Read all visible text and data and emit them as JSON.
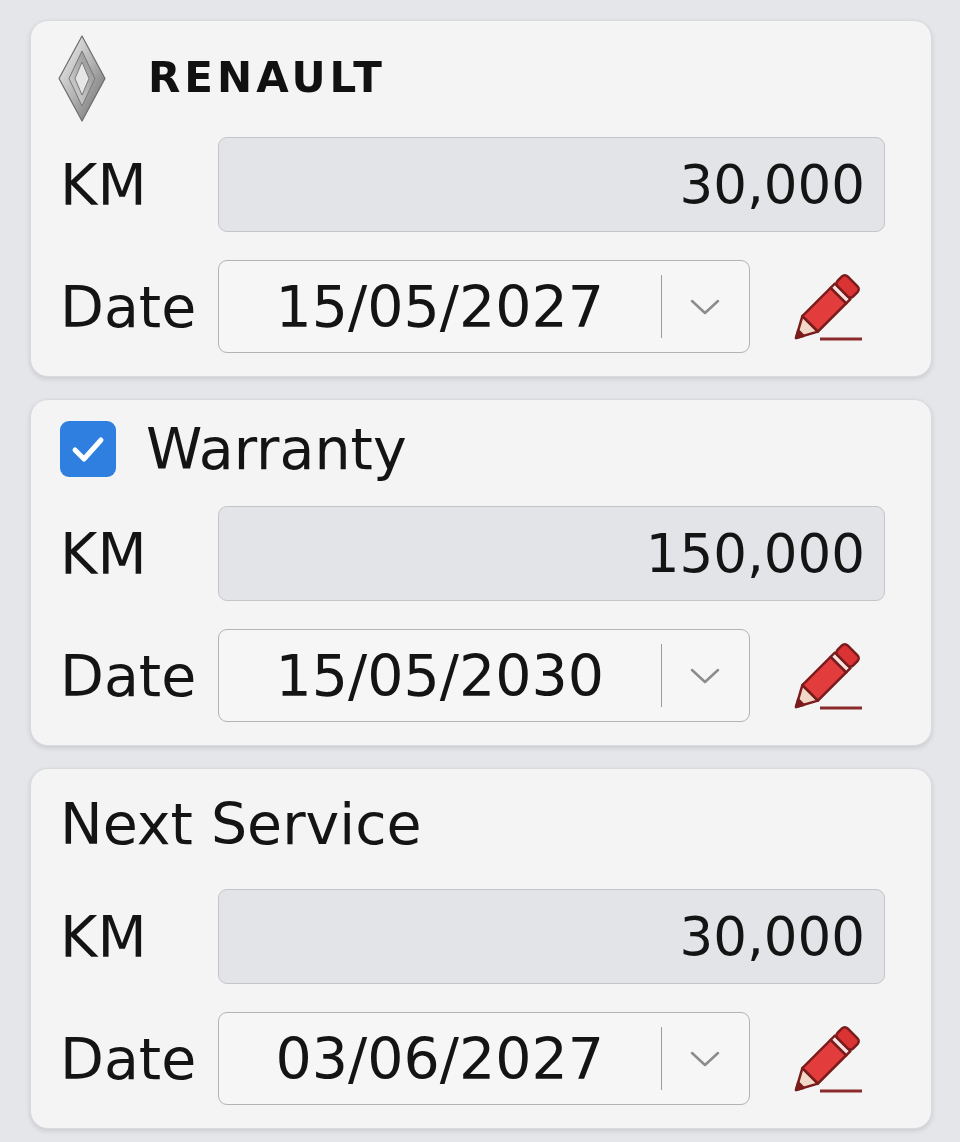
{
  "cards": [
    {
      "kind": "logo",
      "title": "RENAULT",
      "fields": [
        {
          "kind": "number",
          "label": "KM",
          "value": "30,000"
        },
        {
          "kind": "date",
          "label": "Date",
          "value": "15/05/2027"
        }
      ]
    },
    {
      "kind": "checkbox",
      "title": "Warranty",
      "checked": true,
      "fields": [
        {
          "kind": "number",
          "label": "KM",
          "value": "150,000"
        },
        {
          "kind": "date",
          "label": "Date",
          "value": "15/05/2030"
        }
      ]
    },
    {
      "kind": "heading",
      "title": "Next Service",
      "fields": [
        {
          "kind": "number",
          "label": "KM",
          "value": "30,000"
        },
        {
          "kind": "date",
          "label": "Date",
          "value": "03/06/2027"
        }
      ]
    }
  ]
}
